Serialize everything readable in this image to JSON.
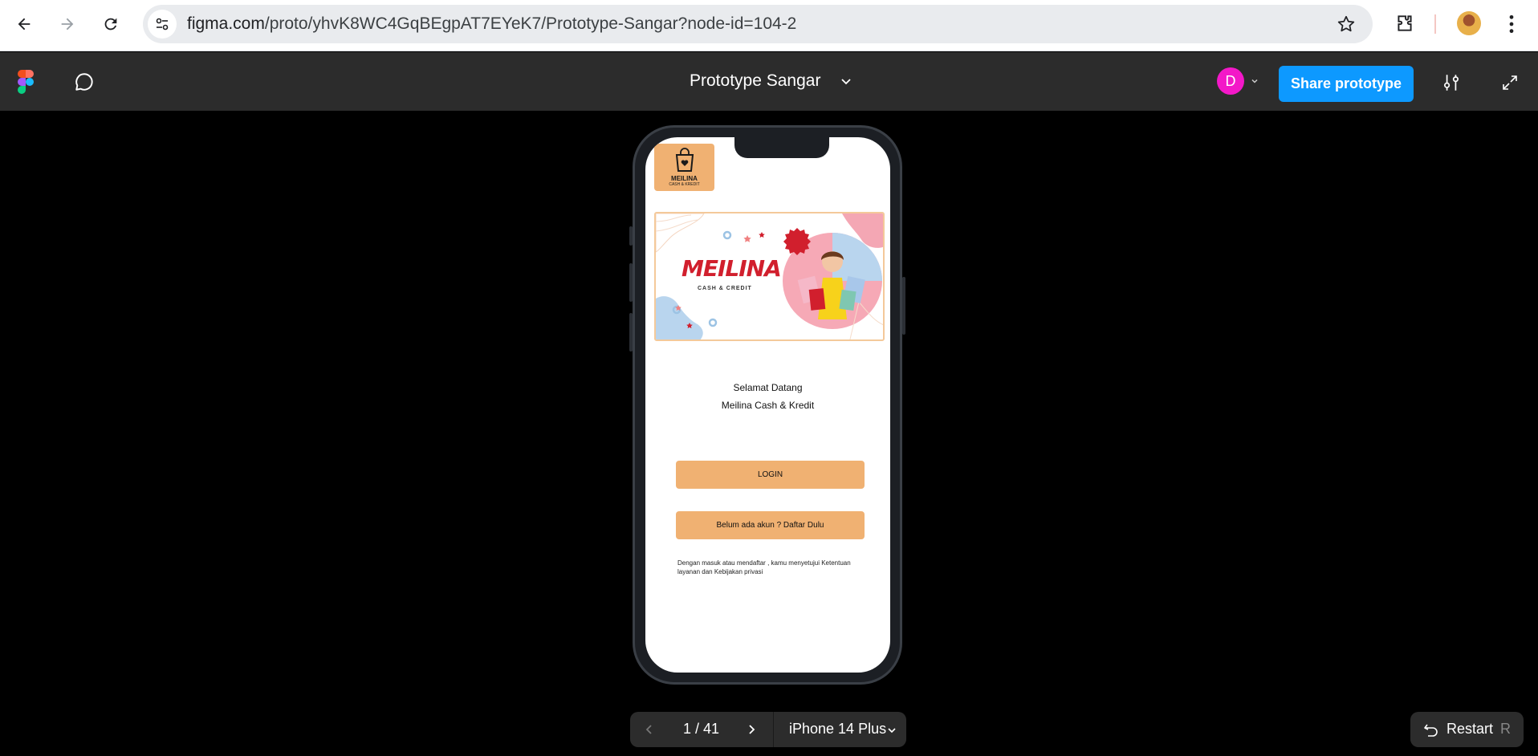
{
  "browser": {
    "url_host": "figma.com",
    "url_path": "/proto/yhvK8WC4GqBEgpAT7EYeK7/Prototype-Sangar?node-id=104-2"
  },
  "figma_toolbar": {
    "prototype_title": "Prototype Sangar",
    "user_initial": "D",
    "user_color": "#f318c8",
    "share_label": "Share prototype",
    "share_color": "#0d99ff"
  },
  "screen": {
    "logo_name": "MEILINA",
    "logo_sub": "CASH & KREDIT",
    "banner_brand": "MEILINA",
    "banner_sub": "CASH & CREDIT",
    "welcome_line1": "Selamat Datang",
    "welcome_line2": "Meilina  Cash & Kredit",
    "login_label": "LOGIN",
    "register_label": "Belum ada akun ? Daftar Dulu",
    "terms_text": "Dengan masuk atau mendaftar , kamu menyetujui Ketentuan layanan dan Kebijakan privasi",
    "accent_color": "#f0b172"
  },
  "bottom_bar": {
    "page_indicator": "1 / 41",
    "device_label": "iPhone 14 Plus",
    "restart_label": "Restart",
    "restart_shortcut": "R"
  }
}
